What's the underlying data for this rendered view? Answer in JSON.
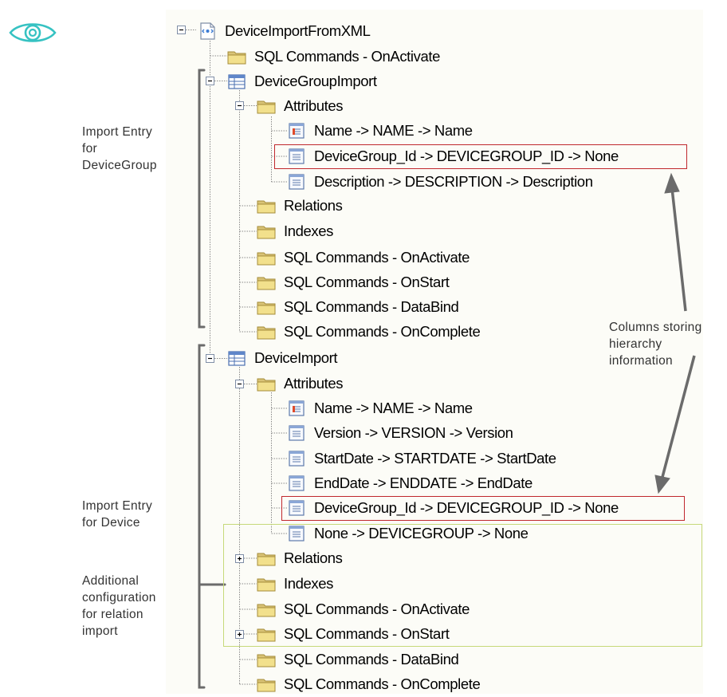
{
  "tree": {
    "root": {
      "label": "DeviceImportFromXML",
      "icon": "xml-document-icon"
    },
    "nodes": [
      {
        "label": "SQL Commands - OnActivate",
        "icon": "folder-icon"
      },
      {
        "label": "DeviceGroupImport",
        "icon": "table-icon",
        "expander": "collapse"
      },
      {
        "label": "Attributes",
        "icon": "folder-icon",
        "expander": "collapse"
      },
      {
        "label": "Name -> NAME -> Name",
        "icon": "key-attribute-icon"
      },
      {
        "label": "DeviceGroup_Id -> DEVICEGROUP_ID -> None",
        "icon": "attribute-icon"
      },
      {
        "label": "Description -> DESCRIPTION -> Description",
        "icon": "attribute-icon"
      },
      {
        "label": "Relations",
        "icon": "folder-icon"
      },
      {
        "label": "Indexes",
        "icon": "folder-icon"
      },
      {
        "label": "SQL Commands - OnActivate",
        "icon": "folder-icon"
      },
      {
        "label": "SQL Commands - OnStart",
        "icon": "folder-icon"
      },
      {
        "label": "SQL Commands - DataBind",
        "icon": "folder-icon"
      },
      {
        "label": "SQL Commands - OnComplete",
        "icon": "folder-icon"
      },
      {
        "label": "DeviceImport",
        "icon": "table-icon",
        "expander": "collapse"
      },
      {
        "label": "Attributes",
        "icon": "folder-icon",
        "expander": "collapse"
      },
      {
        "label": "Name -> NAME -> Name",
        "icon": "key-attribute-icon"
      },
      {
        "label": "Version -> VERSION -> Version",
        "icon": "attribute-icon"
      },
      {
        "label": "StartDate -> STARTDATE -> StartDate",
        "icon": "attribute-icon"
      },
      {
        "label": "EndDate -> ENDDATE -> EndDate",
        "icon": "attribute-icon"
      },
      {
        "label": "DeviceGroup_Id -> DEVICEGROUP_ID -> None",
        "icon": "attribute-icon"
      },
      {
        "label": "None -> DEVICEGROUP -> None",
        "icon": "attribute-icon"
      },
      {
        "label": "Relations",
        "icon": "folder-icon",
        "expander": "expand"
      },
      {
        "label": "Indexes",
        "icon": "folder-icon"
      },
      {
        "label": "SQL Commands - OnActivate",
        "icon": "folder-icon"
      },
      {
        "label": "SQL Commands - OnStart",
        "icon": "folder-icon",
        "expander": "expand"
      },
      {
        "label": "SQL Commands - DataBind",
        "icon": "folder-icon"
      },
      {
        "label": "SQL Commands - OnComplete",
        "icon": "folder-icon"
      }
    ]
  },
  "annotations": {
    "device_group_entry": [
      "Import Entry",
      "for",
      "DeviceGroup"
    ],
    "device_entry": [
      "Import Entry",
      "for Device"
    ],
    "relation_config": [
      "Additional",
      "configuration",
      "for relation",
      "import"
    ],
    "hierarchy_columns": [
      "Columns storing",
      "hierarchy",
      "information"
    ]
  },
  "colors": {
    "highlight_red": "#c0282d",
    "highlight_green": "#c6d97a",
    "eye_icon": "#36c2c2",
    "tree_background": "#fcfcf7",
    "arrow": "#606060"
  }
}
